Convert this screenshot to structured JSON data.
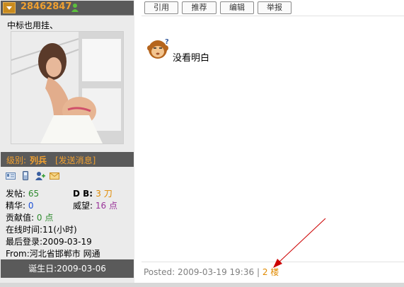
{
  "user": {
    "name": "28462847",
    "signature": "中标也用挂、",
    "rank_label": "级别:",
    "rank_value": "列兵",
    "send_message": "[发送消息]",
    "stats": {
      "posts_label": "发帖:",
      "posts_value": "65",
      "db_label": "D B:",
      "db_value": "3 刀",
      "elite_label": "精华:",
      "elite_value": "0",
      "prestige_label": "威望:",
      "prestige_value": "16 点",
      "contrib_label": "贡献值:",
      "contrib_value": "0 点",
      "online_label": "在线时间:",
      "online_value": "11(小时)",
      "lastlogin_label": "最后登录:",
      "lastlogin_value": "2009-03-19",
      "from_label": "From:",
      "from_value": "河北省邯郸市 网通"
    },
    "birthday": "诞生日:2009-03-06"
  },
  "toolbar": {
    "quote": "引用",
    "recommend": "推荐",
    "edit": "编辑",
    "report": "举报"
  },
  "post": {
    "message": "没看明白",
    "posted": "Posted: 2009-03-19 19:36",
    "separator": "|",
    "floor": "2 楼"
  },
  "colors": {
    "name_orange": "#f0a030",
    "dark_bar": "#5a5a5a",
    "arrow_red": "#cc0000"
  }
}
